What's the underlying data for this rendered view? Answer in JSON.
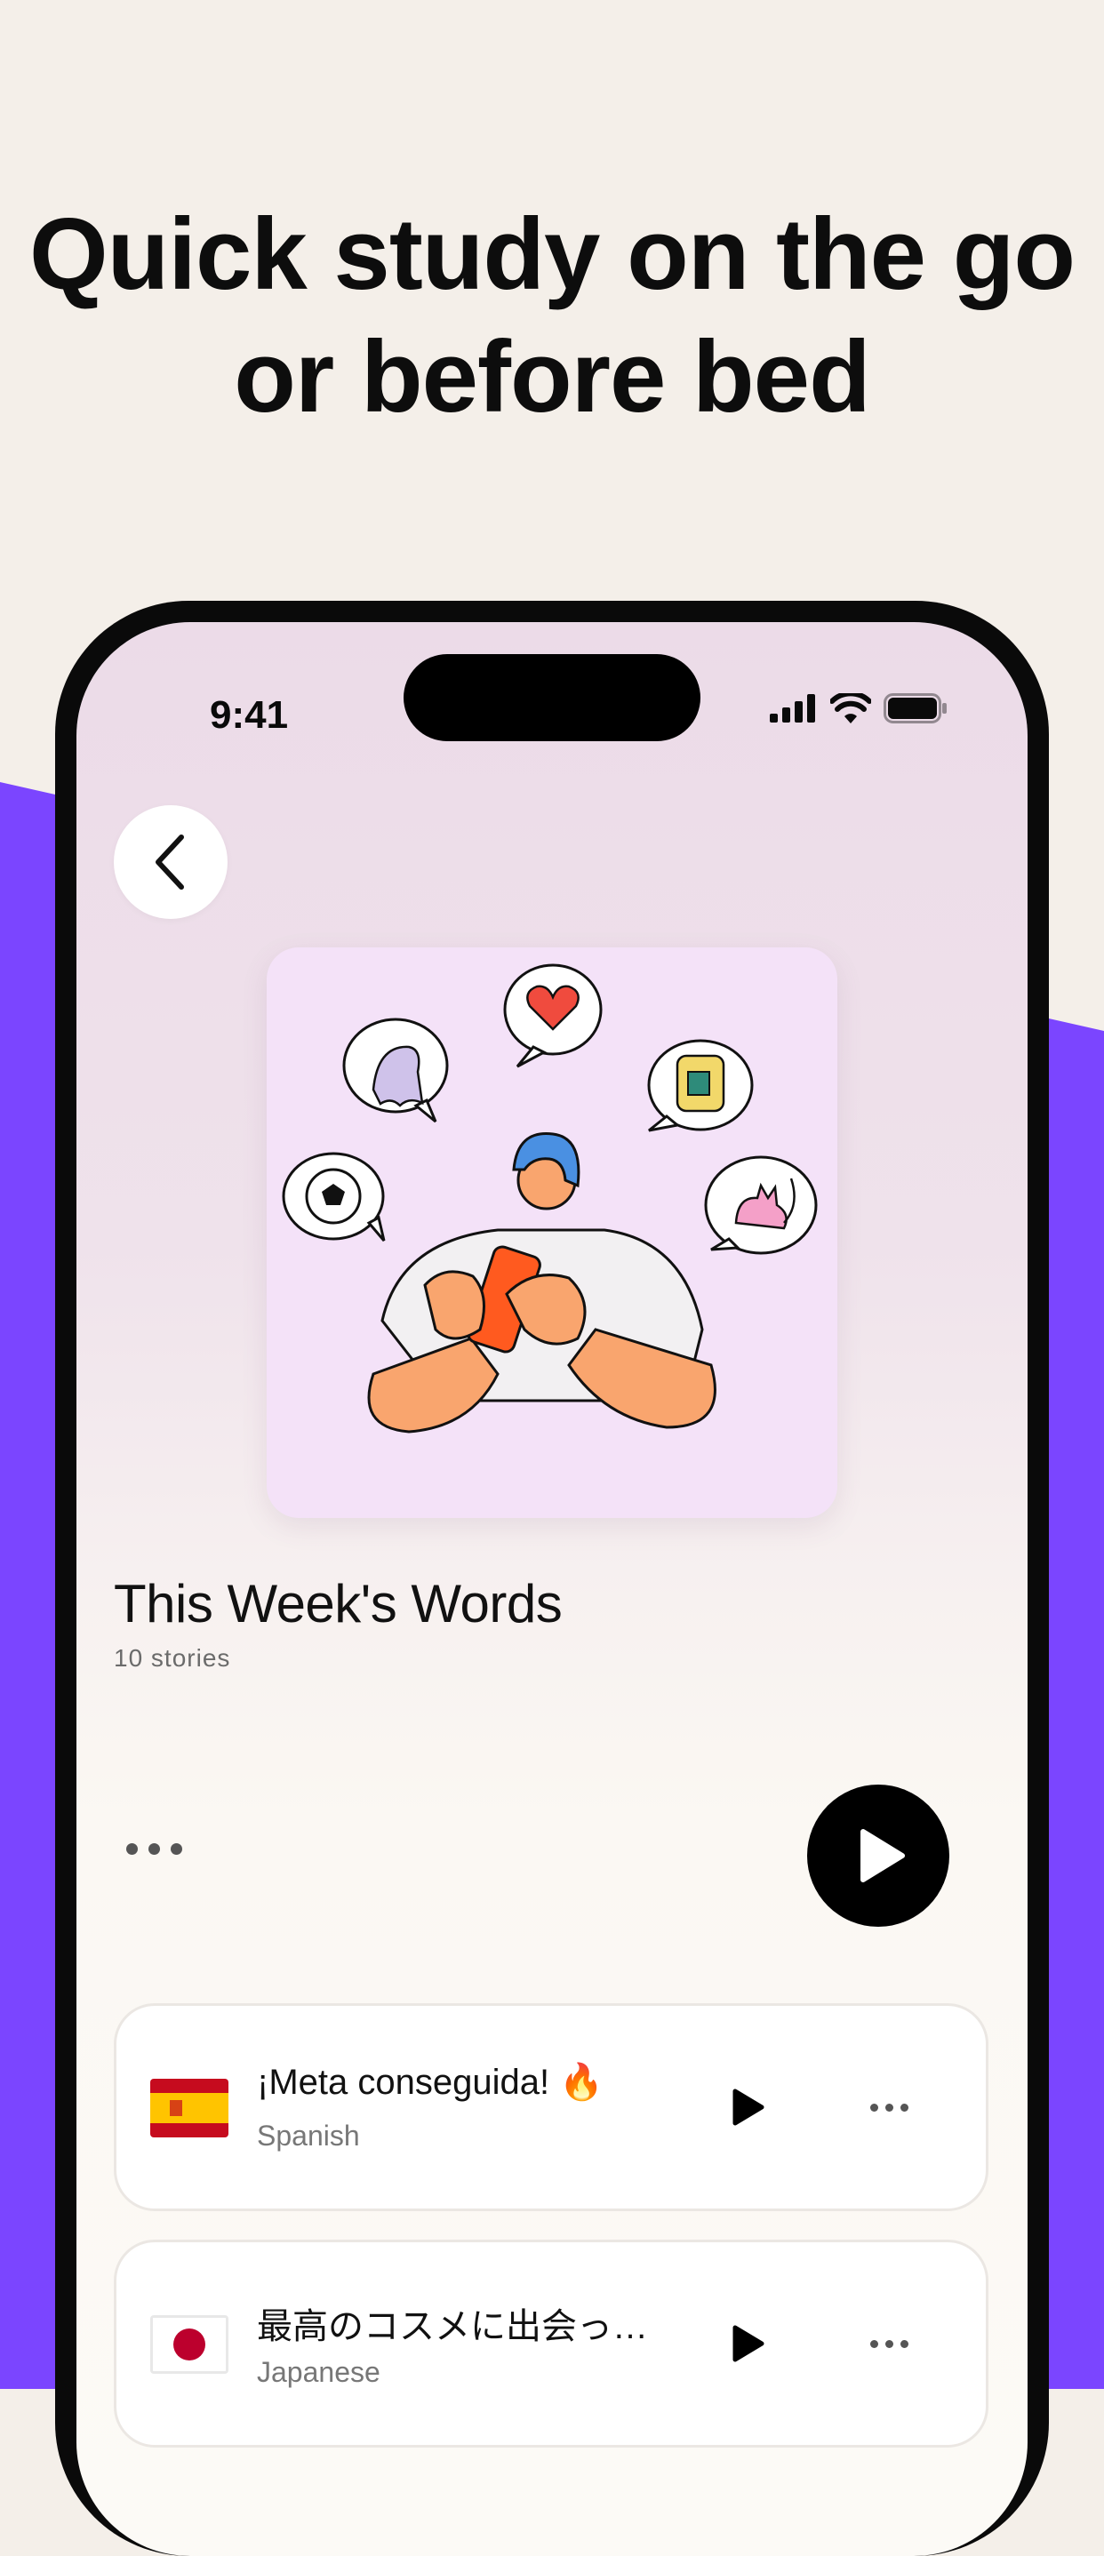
{
  "headline": {
    "line1": "Quick study on the go",
    "line2": "or before bed"
  },
  "colors": {
    "background": "#f4efe9",
    "purple": "#7b45ff",
    "flag_red": "#c60b1e",
    "flag_yellow": "#ffc400",
    "jp_red": "#bc002d"
  },
  "status_bar": {
    "time": "9:41",
    "icons": [
      "cellular-signal-icon",
      "wifi-icon",
      "battery-icon"
    ]
  },
  "collection": {
    "back_icon": "chevron-left-icon",
    "title": "This Week's Words",
    "subtitle": "10 stories",
    "more_icon": "more-horizontal-icon",
    "play_icon": "play-icon"
  },
  "stories": [
    {
      "title": "¡Meta conseguida! 🔥",
      "language": "Spanish",
      "flag": "spain-flag-icon"
    },
    {
      "title": "最高のコスメに出会っ…",
      "language": "Japanese",
      "flag": "japan-flag-icon"
    }
  ]
}
